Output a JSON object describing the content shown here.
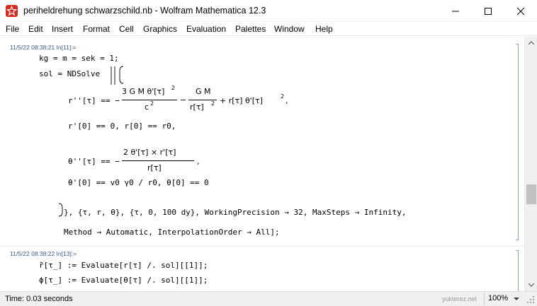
{
  "window": {
    "title": "periheldrehung schwarzschild.nb - Wolfram Mathematica 12.3",
    "icons": {
      "app": "mathematica-spikey-icon",
      "minimize": "minimize-icon",
      "maximize": "maximize-icon",
      "close": "close-icon"
    },
    "accent_color": "#d62b1e"
  },
  "menu": {
    "items": [
      "File",
      "Edit",
      "Insert",
      "Format",
      "Cell",
      "Graphics",
      "Evaluation",
      "Palettes",
      "Window",
      "Help"
    ]
  },
  "cells": [
    {
      "label": "11/5/22 08:38:21 In[11]:=",
      "line1": "kg = m = sek = 1;",
      "sol_prefix": "sol = NDSolve",
      "eq1": {
        "lhs": "r''[τ] == −",
        "num1": "3 G M θ'[τ]",
        "num1_exp": "2",
        "den1": "c",
        "den1_exp": "2",
        "minus": "−",
        "num2": "G M",
        "den2": "r[τ]",
        "den2_exp": "2",
        "tail": "+ r[τ] θ'[τ]",
        "tail_exp": "2",
        "comma": ","
      },
      "ic1": "r'[0] == 0,  r[0] == r0,",
      "eq2": {
        "lhs": "θ''[τ] == −",
        "num": "2 θ'[τ] × r'[τ]",
        "den": "r[τ]",
        "comma": ","
      },
      "ic2": "θ'[0] == v0 γ0 / r0,  θ[0] == 0",
      "options_line1": "}, {τ, r, θ}, {τ, 0, 100 dy}, WorkingPrecision → 32, MaxSteps → Infinity,",
      "options_line2": "Method → Automatic, InterpolationOrder → All];"
    },
    {
      "label": "11/5/22 08:38:22 In[13]:=",
      "line1": "r̃[τ_] := Evaluate[r[τ] /. sol][[1]];",
      "line2": "ϕ[τ_] := Evaluate[θ[τ] /. sol][[1]];"
    }
  ],
  "status": {
    "time": "Time: 0.03 seconds",
    "watermark": "yukterez.net",
    "zoom": "100%"
  }
}
